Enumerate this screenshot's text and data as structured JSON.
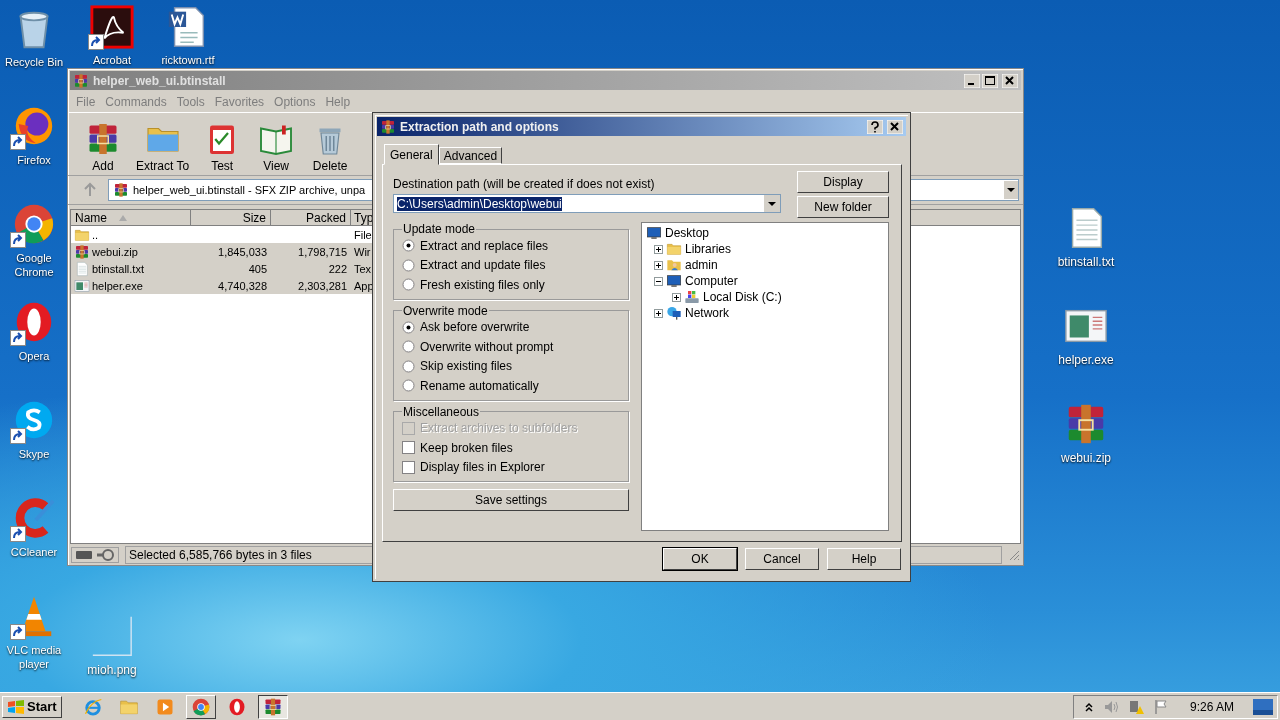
{
  "desktop": {
    "left_column": [
      {
        "label": "Recycle Bin",
        "kind": "recycle",
        "shortcut": false
      },
      {
        "label": "Firefox",
        "kind": "firefox",
        "shortcut": true
      },
      {
        "label": "Google Chrome",
        "kind": "chrome",
        "shortcut": true
      },
      {
        "label": "Opera",
        "kind": "opera",
        "shortcut": true
      },
      {
        "label": "Skype",
        "kind": "skype",
        "shortcut": true
      },
      {
        "label": "CCleaner",
        "kind": "ccleaner",
        "shortcut": true
      },
      {
        "label": "VLC media player",
        "kind": "vlc",
        "shortcut": true
      }
    ],
    "top_row": [
      {
        "label": "Acrobat",
        "kind": "acrobat",
        "shortcut": true
      },
      {
        "label": "ricktown.rtf",
        "kind": "word",
        "shortcut": false
      }
    ],
    "lower_row": [
      {
        "label": "mioh.png",
        "kind": "image",
        "shortcut": false
      }
    ],
    "right_column": [
      {
        "label": "btinstall.txt",
        "kind": "text",
        "shortcut": false
      },
      {
        "label": "helper.exe",
        "kind": "exe",
        "shortcut": false
      },
      {
        "label": "webui.zip",
        "kind": "rar",
        "shortcut": false
      }
    ]
  },
  "archive_window": {
    "title": "helper_web_ui.btinstall",
    "menu": [
      "File",
      "Commands",
      "Tools",
      "Favorites",
      "Options",
      "Help"
    ],
    "toolbar": [
      {
        "label": "Add",
        "kind": "add"
      },
      {
        "label": "Extract To",
        "kind": "extract"
      },
      {
        "label": "Test",
        "kind": "test"
      },
      {
        "label": "View",
        "kind": "view"
      },
      {
        "label": "Delete",
        "kind": "delete"
      }
    ],
    "address": "helper_web_ui.btinstall - SFX ZIP archive, unpa",
    "columns": [
      "Name",
      "Size",
      "Packed",
      "Typ"
    ],
    "rows": [
      {
        "name": "..",
        "type": "File",
        "kind": "folder",
        "selected": false
      },
      {
        "name": "webui.zip",
        "size": "1,845,033",
        "packed": "1,798,715",
        "type": "Wir",
        "kind": "rar",
        "selected": true
      },
      {
        "name": "btinstall.txt",
        "size": "405",
        "packed": "222",
        "type": "Tex",
        "kind": "text",
        "selected": true
      },
      {
        "name": "helper.exe",
        "size": "4,740,328",
        "packed": "2,303,281",
        "type": "App",
        "kind": "exe",
        "selected": true
      }
    ],
    "status": "Selected 6,585,766 bytes in 3 files"
  },
  "dialog": {
    "title": "Extraction path and options",
    "tabs": [
      {
        "label": "General",
        "selected": true
      },
      {
        "label": "Advanced",
        "selected": false
      }
    ],
    "destination_label": "Destination path (will be created if does not exist)",
    "destination_value": "C:\\Users\\admin\\Desktop\\webui",
    "side_buttons": [
      "Display",
      "New folder"
    ],
    "groups": [
      {
        "title": "Update mode",
        "kind": "radio",
        "options": [
          {
            "label": "Extract and replace files",
            "selected": true
          },
          {
            "label": "Extract and update files",
            "selected": false
          },
          {
            "label": "Fresh existing files only",
            "selected": false
          }
        ]
      },
      {
        "title": "Overwrite mode",
        "kind": "radio",
        "options": [
          {
            "label": "Ask before overwrite",
            "selected": true
          },
          {
            "label": "Overwrite without prompt",
            "selected": false
          },
          {
            "label": "Skip existing files",
            "selected": false
          },
          {
            "label": "Rename automatically",
            "selected": false
          }
        ]
      },
      {
        "title": "Miscellaneous",
        "kind": "checkbox",
        "options": [
          {
            "label": "Extract archives to subfolders",
            "checked": false,
            "disabled": true
          },
          {
            "label": "Keep broken files",
            "checked": false,
            "disabled": false
          },
          {
            "label": "Display files in Explorer",
            "checked": false,
            "disabled": false
          }
        ]
      }
    ],
    "save_button": "Save settings",
    "tree": [
      {
        "label": "Desktop",
        "kind": "desktop",
        "children": [
          {
            "label": "Libraries",
            "kind": "libraries",
            "expanded": false
          },
          {
            "label": "admin",
            "kind": "user",
            "expanded": false
          },
          {
            "label": "Computer",
            "kind": "computer",
            "expanded": true,
            "children": [
              {
                "label": "Local Disk (C:)",
                "kind": "disk",
                "expanded": false
              }
            ]
          },
          {
            "label": "Network",
            "kind": "network",
            "expanded": false
          }
        ]
      }
    ],
    "buttons": [
      {
        "label": "OK",
        "default": true
      },
      {
        "label": "Cancel",
        "default": false
      },
      {
        "label": "Help",
        "default": false
      }
    ]
  },
  "taskbar": {
    "start": "Start",
    "apps": [
      {
        "kind": "ie",
        "running": false,
        "selected": false
      },
      {
        "kind": "explorer",
        "running": false,
        "selected": false
      },
      {
        "kind": "media",
        "running": false,
        "selected": false
      },
      {
        "kind": "chrome",
        "running": true,
        "selected": false
      },
      {
        "kind": "opera",
        "running": false,
        "selected": false
      },
      {
        "kind": "rar",
        "running": true,
        "selected": true
      }
    ],
    "clock": "9:26 AM"
  }
}
